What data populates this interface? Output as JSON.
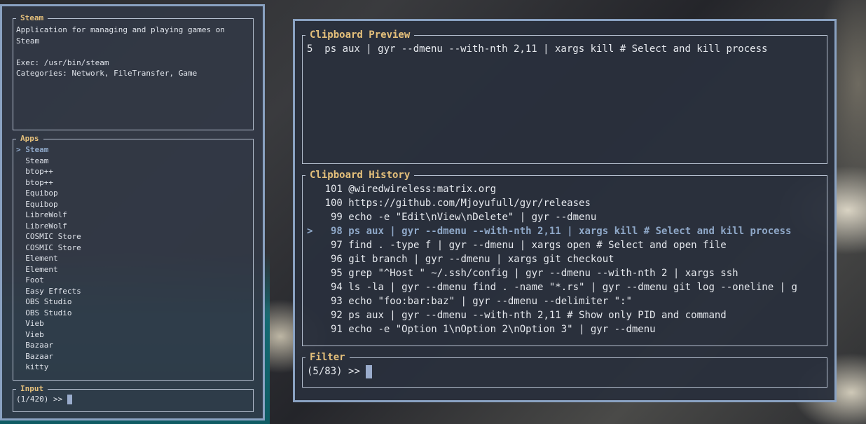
{
  "launcher": {
    "details_title": "Steam",
    "details_lines": [
      "Application for managing and playing games on",
      "Steam",
      "",
      "Exec: /usr/bin/steam",
      "Categories: Network, FileTransfer, Game"
    ],
    "apps_title": "Apps",
    "selected_marker": "> ",
    "apps": [
      "Steam",
      "Steam",
      "btop++",
      "btop++",
      "Equibop",
      "Equibop",
      "LibreWolf",
      "LibreWolf",
      "COSMIC Store",
      "COSMIC Store",
      "Element",
      "Element",
      "Foot",
      "Easy Effects",
      "OBS Studio",
      "OBS Studio",
      "Vieb",
      "Vieb",
      "Bazaar",
      "Bazaar",
      "kitty"
    ],
    "input_title": "Input",
    "input_count": "(1/420)",
    "input_prompt": ">>"
  },
  "clipboard": {
    "preview_title": "Clipboard Preview",
    "preview_text": "5  ps aux | gyr --dmenu --with-nth 2,11 | xargs kill # Select and kill process",
    "history_title": "Clipboard History",
    "selected_marker": "> ",
    "history": [
      {
        "id": "101",
        "text": "@wiredwireless:matrix.org"
      },
      {
        "id": "100",
        "text": "https://github.com/Mjoyufull/gyr/releases"
      },
      {
        "id": "99",
        "text": "echo -e \"Edit\\nView\\nDelete\" | gyr --dmenu"
      },
      {
        "id": "98",
        "text": "ps aux | gyr --dmenu --with-nth 2,11 | xargs kill # Select and kill process"
      },
      {
        "id": "97",
        "text": "find . -type f | gyr --dmenu | xargs open # Select and open file"
      },
      {
        "id": "96",
        "text": "git branch | gyr --dmenu | xargs git checkout"
      },
      {
        "id": "95",
        "text": "grep \"^Host \" ~/.ssh/config | gyr --dmenu --with-nth 2 | xargs ssh"
      },
      {
        "id": "94",
        "text": "ls -la | gyr --dmenu find . -name \"*.rs\" | gyr --dmenu git log --oneline | g"
      },
      {
        "id": "93",
        "text": "echo \"foo:bar:baz\" | gyr --dmenu --delimiter \":\""
      },
      {
        "id": "92",
        "text": "ps aux | gyr --dmenu --with-nth 2,11 # Show only PID and command"
      },
      {
        "id": "91",
        "text": "echo -e \"Option 1\\nOption 2\\nOption 3\" | gyr --dmenu"
      }
    ],
    "filter_title": "Filter",
    "filter_count": "(5/83)",
    "filter_prompt": ">>"
  },
  "colors": {
    "border": "#8aa2c2",
    "title": "#e5c07b",
    "selected": "#8fa8c8",
    "text": "#e6e9ee"
  }
}
